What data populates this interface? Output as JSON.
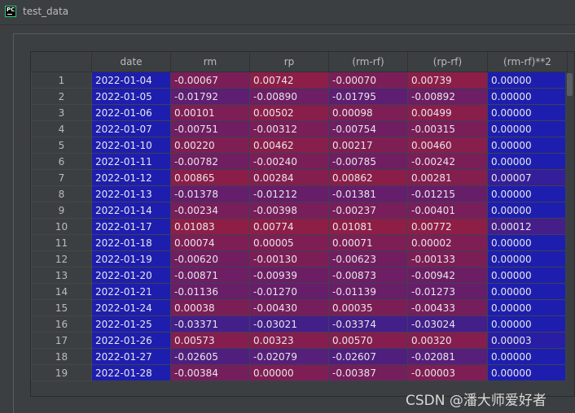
{
  "window": {
    "title": "test_data",
    "app_icon": "pycharm-icon"
  },
  "table": {
    "columns": [
      "",
      "date",
      "rm",
      "rp",
      "(rm-rf)",
      "(rp-rf)",
      "(rm-rf)**2"
    ],
    "rows": [
      [
        "1",
        "2022-01-04",
        "-0.00067",
        "0.00742",
        "-0.00070",
        "0.00739",
        "0.00000"
      ],
      [
        "2",
        "2022-01-05",
        "-0.01792",
        "-0.00890",
        "-0.01795",
        "-0.00892",
        "0.00000"
      ],
      [
        "3",
        "2022-01-06",
        "0.00101",
        "0.00502",
        "0.00098",
        "0.00499",
        "0.00000"
      ],
      [
        "4",
        "2022-01-07",
        "-0.00751",
        "-0.00312",
        "-0.00754",
        "-0.00315",
        "0.00000"
      ],
      [
        "5",
        "2022-01-10",
        "0.00220",
        "0.00462",
        "0.00217",
        "0.00460",
        "0.00000"
      ],
      [
        "6",
        "2022-01-11",
        "-0.00782",
        "-0.00240",
        "-0.00785",
        "-0.00242",
        "0.00000"
      ],
      [
        "7",
        "2022-01-12",
        "0.00865",
        "0.00284",
        "0.00862",
        "0.00281",
        "0.00007"
      ],
      [
        "8",
        "2022-01-13",
        "-0.01378",
        "-0.01212",
        "-0.01381",
        "-0.01215",
        "0.00000"
      ],
      [
        "9",
        "2022-01-14",
        "-0.00234",
        "-0.00398",
        "-0.00237",
        "-0.00401",
        "0.00000"
      ],
      [
        "10",
        "2022-01-17",
        "0.01083",
        "0.00774",
        "0.01081",
        "0.00772",
        "0.00012"
      ],
      [
        "11",
        "2022-01-18",
        "0.00074",
        "0.00005",
        "0.00071",
        "0.00002",
        "0.00000"
      ],
      [
        "12",
        "2022-01-19",
        "-0.00620",
        "-0.00130",
        "-0.00623",
        "-0.00133",
        "0.00000"
      ],
      [
        "13",
        "2022-01-20",
        "-0.00871",
        "-0.00939",
        "-0.00873",
        "-0.00942",
        "0.00000"
      ],
      [
        "14",
        "2022-01-21",
        "-0.01136",
        "-0.01270",
        "-0.01139",
        "-0.01273",
        "0.00000"
      ],
      [
        "15",
        "2022-01-24",
        "0.00038",
        "-0.00430",
        "0.00035",
        "-0.00433",
        "0.00000"
      ],
      [
        "16",
        "2022-01-25",
        "-0.03371",
        "-0.03021",
        "-0.03374",
        "-0.03024",
        "0.00000"
      ],
      [
        "17",
        "2022-01-26",
        "0.00573",
        "0.00323",
        "0.00570",
        "0.00320",
        "0.00003"
      ],
      [
        "18",
        "2022-01-27",
        "-0.02605",
        "-0.02079",
        "-0.02607",
        "-0.02081",
        "0.00000"
      ],
      [
        "19",
        "2022-01-28",
        "-0.00384",
        "0.00000",
        "-0.00387",
        "-0.00003",
        "0.00000"
      ]
    ],
    "cell_colors": {
      "date_column": "#1e1eae",
      "range_low": "#2a1fa0",
      "range_high": "#8e1e46",
      "square_column": "#1e1eae"
    }
  },
  "watermark": "CSDN @潘大师爱好者"
}
